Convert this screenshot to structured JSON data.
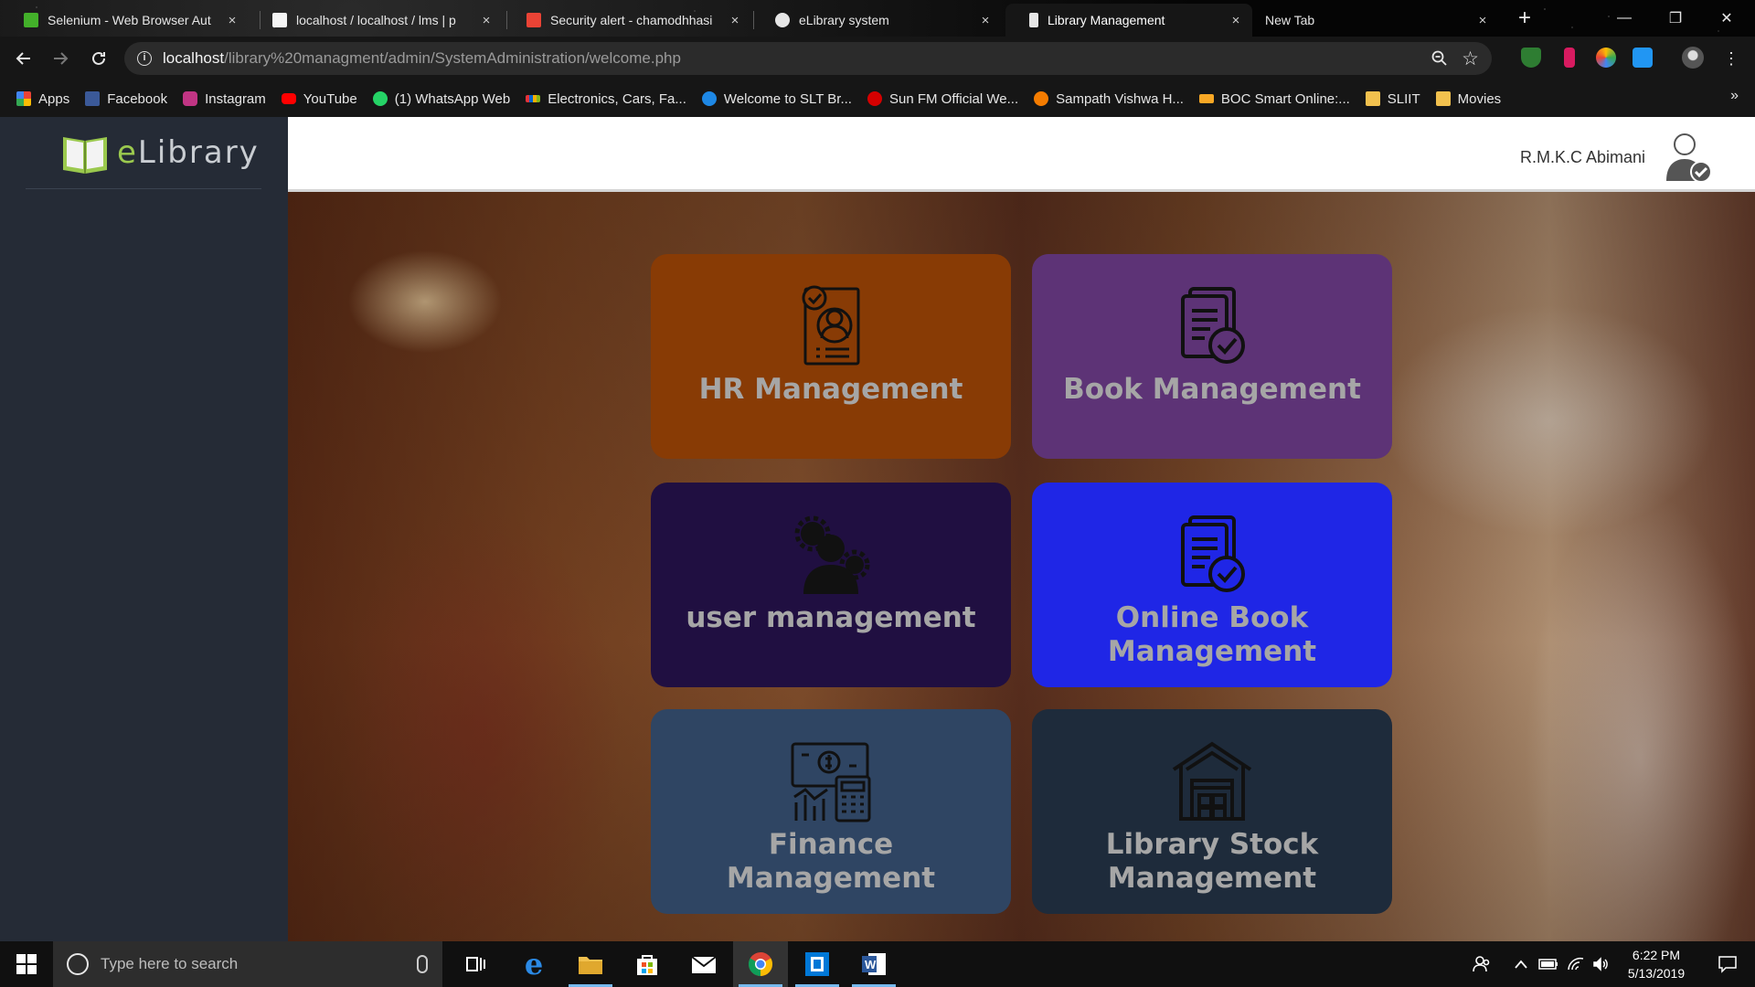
{
  "browser": {
    "tabs": [
      {
        "title": "Selenium - Web Browser Aut",
        "favicon_color": "#43b02a",
        "active": false
      },
      {
        "title": "localhost / localhost / lms | p",
        "favicon_color": "#f5f5f5",
        "active": false
      },
      {
        "title": "Security alert - chamodhhasi",
        "favicon_color": "#ea4335",
        "active": false
      },
      {
        "title": "eLibrary system",
        "favicon_color": "#e6e6e6",
        "active": false
      },
      {
        "title": "Library Management",
        "favicon_color": "#e6e6e6",
        "active": true
      },
      {
        "title": "New Tab",
        "favicon_color": "",
        "active": false
      }
    ],
    "close_glyph": "×",
    "new_tab_glyph": "+",
    "window_controls": {
      "minimize": "—",
      "restore": "❐",
      "close": "✕"
    },
    "url_host": "localhost",
    "url_path": "/library%20managment/admin/SystemAdministration/welcome.php",
    "bookmarks": [
      {
        "label": "Apps",
        "icon_color": "#e94235"
      },
      {
        "label": "Facebook",
        "icon_color": "#3b5998"
      },
      {
        "label": "Instagram",
        "icon_color": "#c13584"
      },
      {
        "label": "YouTube",
        "icon_color": "#ff0000"
      },
      {
        "label": "(1) WhatsApp Web",
        "icon_color": "#25d366"
      },
      {
        "label": "Electronics, Cars, Fa...",
        "icon_color": "#f5af02"
      },
      {
        "label": "Welcome to SLT Br...",
        "icon_color": "#1e88e5"
      },
      {
        "label": "Sun FM Official We...",
        "icon_color": "#d50000"
      },
      {
        "label": "Sampath Vishwa H...",
        "icon_color": "#f57c00"
      },
      {
        "label": "BOC Smart Online:...",
        "icon_color": "#f9a825"
      },
      {
        "label": "SLIIT",
        "icon_color": "#f2c14e"
      },
      {
        "label": "Movies",
        "icon_color": "#f2c14e"
      }
    ],
    "bookmarks_overflow": "»"
  },
  "app": {
    "logo_e": "e",
    "logo_rest": "Library",
    "user_name": "R.M.K.C Abimani",
    "cards": [
      {
        "label": "HR Management",
        "icon": "hr-profile-icon",
        "bg": "#883b05"
      },
      {
        "label": "Book Management",
        "icon": "book-check-icon",
        "bg": "#5d3376"
      },
      {
        "label": "user management",
        "icon": "user-gears-icon",
        "bg": "#200f41"
      },
      {
        "label": "Online Book Management",
        "icon": "book-check-icon",
        "bg": "#1f26e6"
      },
      {
        "label": "Finance Management",
        "icon": "finance-calculator-icon",
        "bg": "#2f4563"
      },
      {
        "label": "Library Stock Management",
        "icon": "warehouse-icon",
        "bg": "#1e2b3b"
      }
    ]
  },
  "taskbar": {
    "search_placeholder": "Type here to search",
    "time": "6:22 PM",
    "date": "5/13/2019"
  }
}
